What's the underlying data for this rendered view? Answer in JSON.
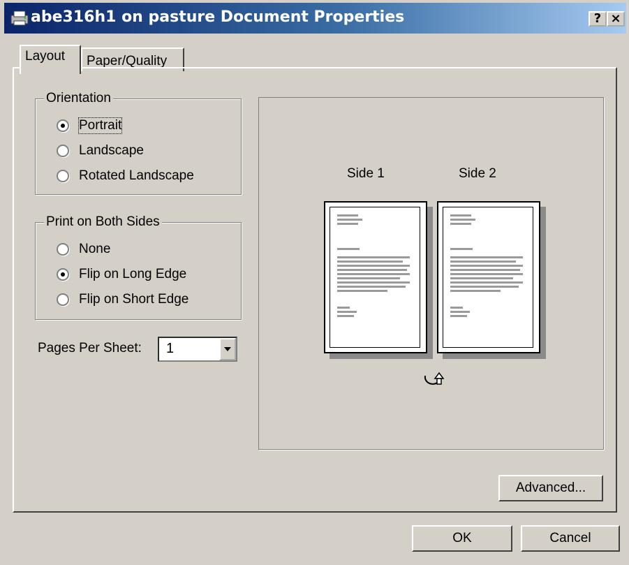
{
  "window": {
    "title": "abe316h1 on pasture Document Properties",
    "help_label": "?",
    "close_label": "×"
  },
  "tabs": [
    {
      "label": "Layout",
      "active": true
    },
    {
      "label": "Paper/Quality",
      "active": false
    }
  ],
  "orientation": {
    "legend": "Orientation",
    "options": [
      {
        "label": "Portrait",
        "checked": true
      },
      {
        "label": "Landscape",
        "checked": false
      },
      {
        "label": "Rotated Landscape",
        "checked": false
      }
    ]
  },
  "both_sides": {
    "legend": "Print on Both Sides",
    "options": [
      {
        "label": "None",
        "checked": false
      },
      {
        "label": "Flip on Long Edge",
        "checked": true
      },
      {
        "label": "Flip on Short Edge",
        "checked": false
      }
    ]
  },
  "pages_per_sheet": {
    "label": "Pages Per Sheet:",
    "value": "1"
  },
  "preview": {
    "side1": "Side 1",
    "side2": "Side 2"
  },
  "buttons": {
    "advanced": "Advanced...",
    "ok": "OK",
    "cancel": "Cancel"
  }
}
